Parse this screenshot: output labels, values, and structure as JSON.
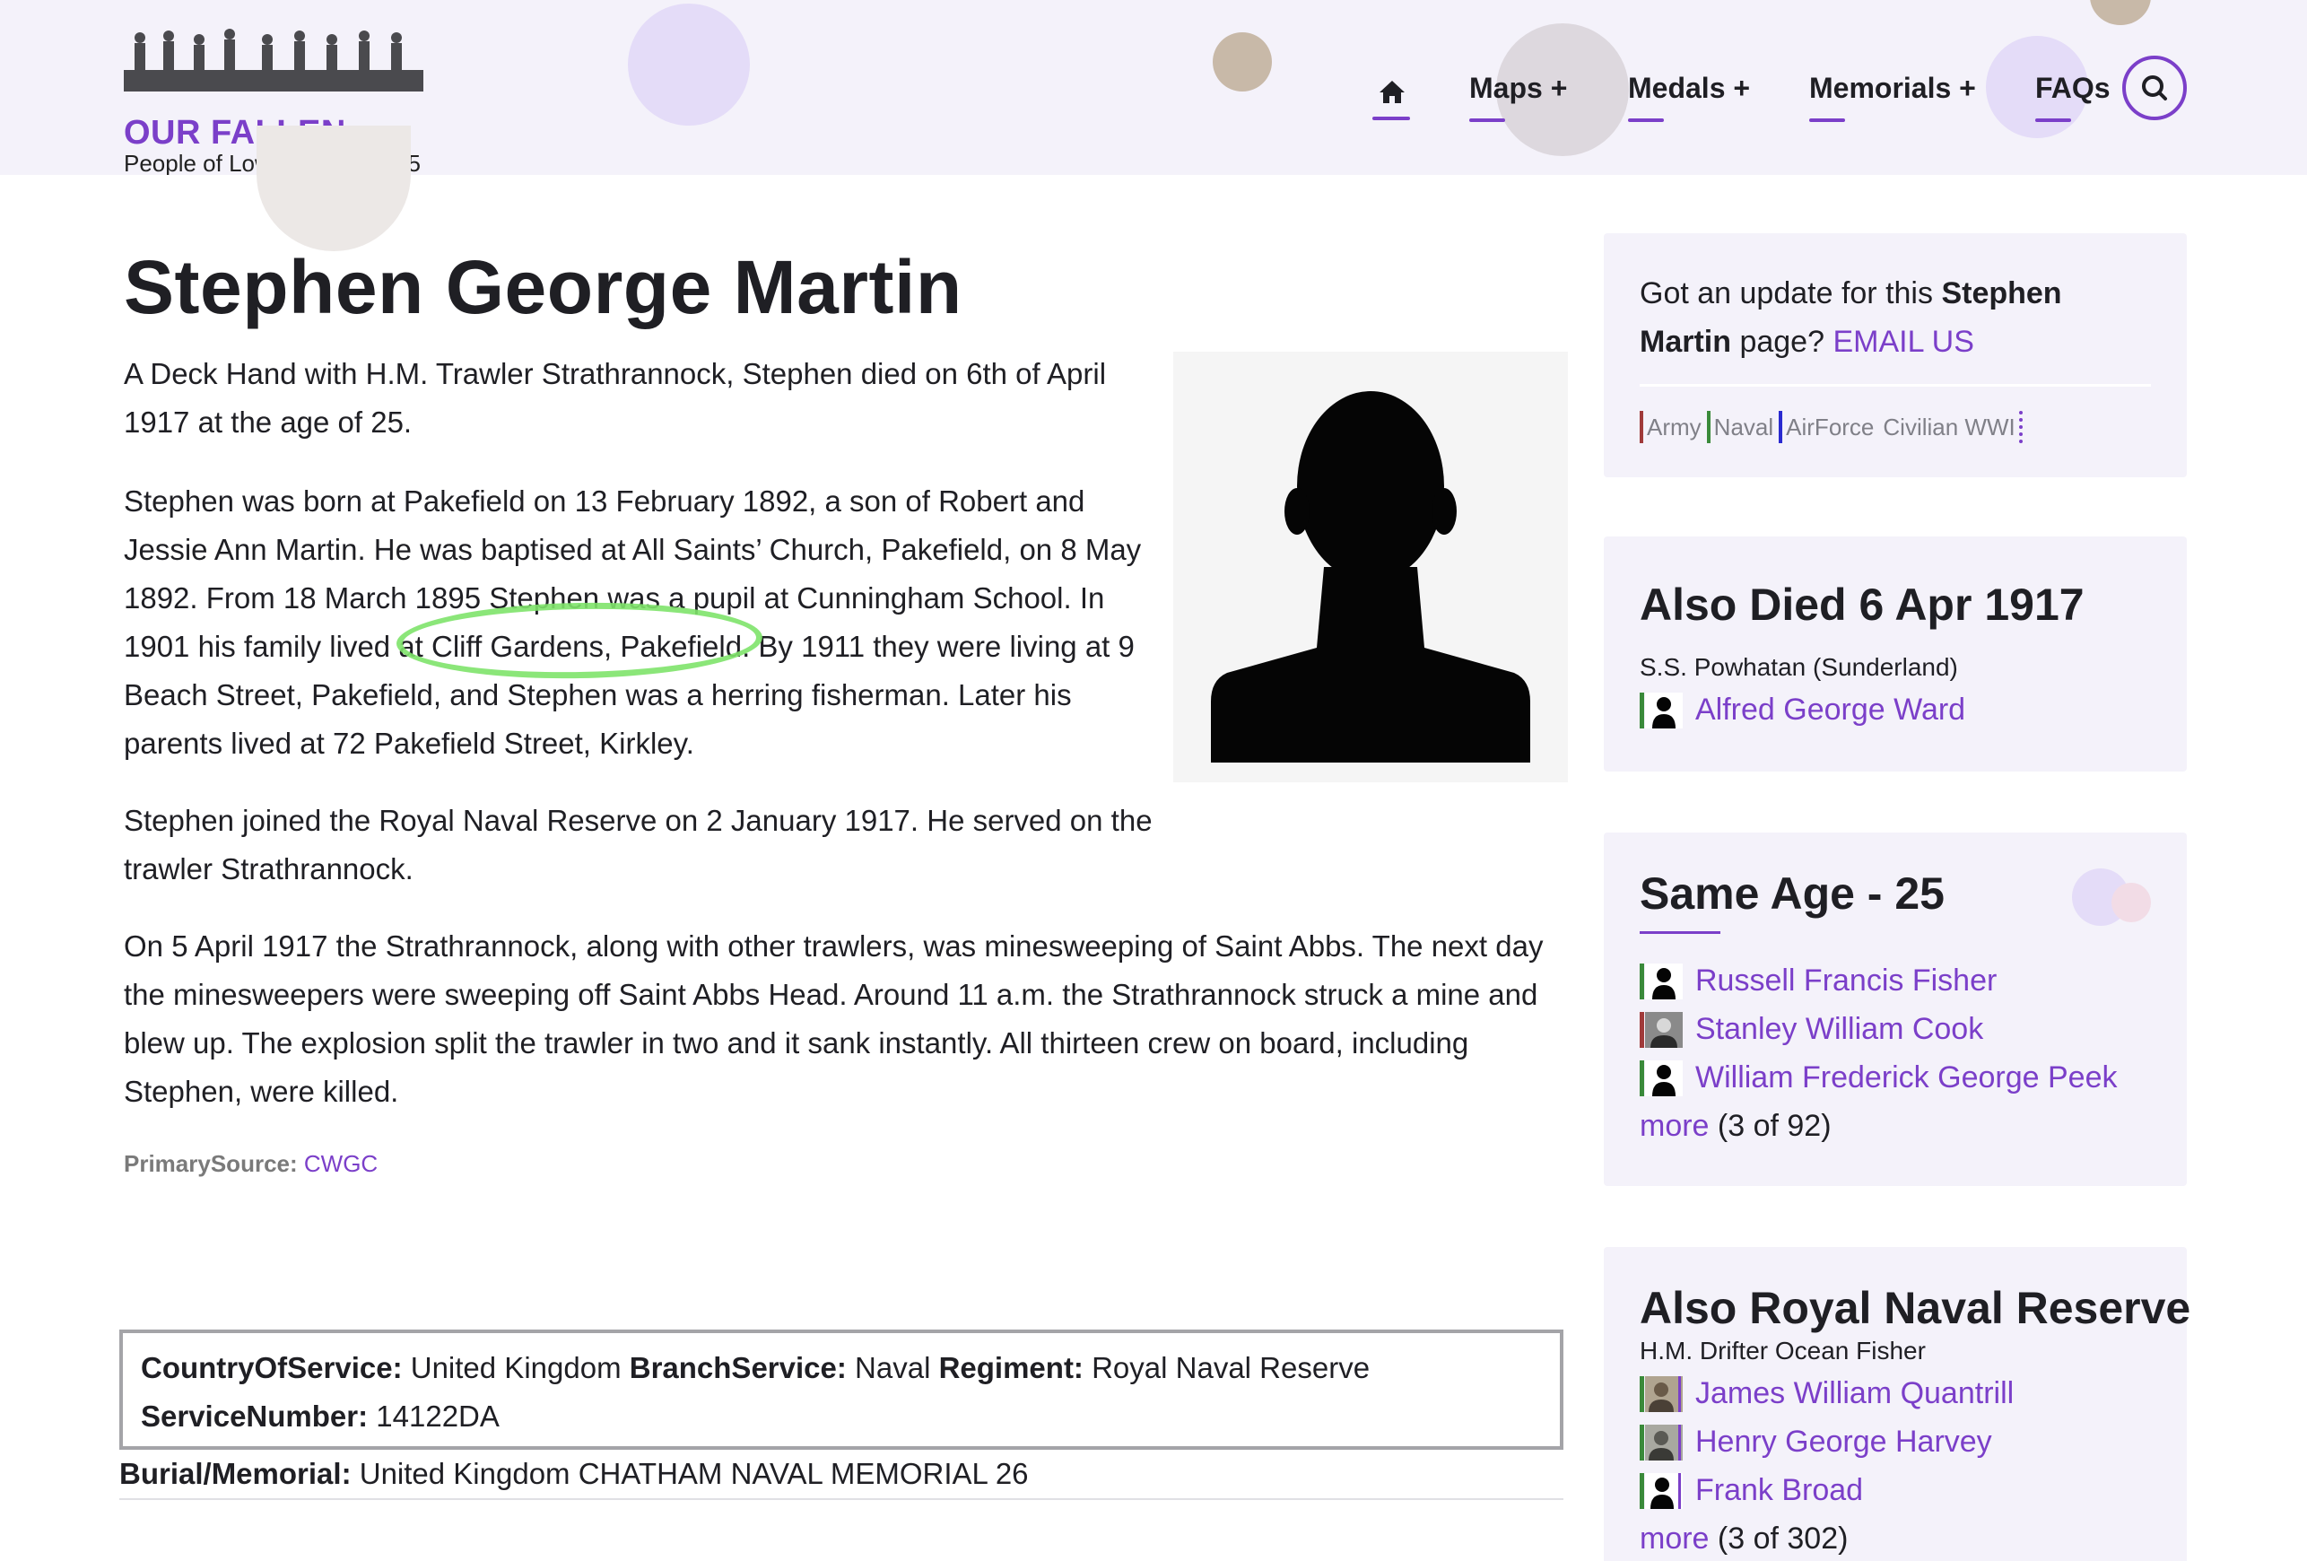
{
  "header": {
    "logo_title": "OUR FALLEN",
    "logo_subtitle": "People of Lowestoft 1914-45",
    "nav": [
      {
        "label": "Maps +"
      },
      {
        "label": "Medals +"
      },
      {
        "label": "Memorials +"
      },
      {
        "label": "FAQs"
      }
    ],
    "icons": {
      "home": "home-icon",
      "search": "search-icon"
    },
    "accent_color": "#7b3fc9"
  },
  "article": {
    "title": "Stephen George Martin",
    "paragraphs": [
      "A Deck Hand with H.M. Trawler Strathrannock, Stephen died on 6th of April 1917 at the age of 25.",
      "Stephen was born at Pakefield on 13 February 1892, a son of Robert and Jessie Ann Martin. He was baptised at All Saints’ Church, Pakefield, on 8 May 1892. From 18 March 1895 Stephen was a pupil at Cunningham School. In 1901 his family lived at Cliff Gardens, Pakefield. By 1911 they were living at 9 Beach Street, Pakefield, and Stephen was a herring fisherman. Later his parents lived at 72 Pakefield Street, Kirkley.",
      "Stephen joined the Royal Naval Reserve on 2 January 1917. He served on the trawler Strathrannock.",
      "On 5 April 1917 the Strathrannock, along with other trawlers, was minesweeping of Saint Abbs. The next day the minesweepers were sweeping off Saint Abbs Head. Around 11 a.m. the Strathrannock struck a mine and blew up. The explosion split the trawler in two and it sank instantly. All thirteen crew on board, including Stephen, were killed."
    ],
    "source_label": "PrimarySource:",
    "source_value": "CWGC"
  },
  "service": {
    "country_label": "CountryOfService:",
    "country_value": "United Kingdom",
    "branch_label": "BranchService:",
    "branch_value": "Naval",
    "regiment_label": "Regiment:",
    "regiment_value": "Royal Naval Reserve",
    "number_label": "ServiceNumber:",
    "number_value": "14122DA",
    "burial_label": "Burial/Memorial:",
    "burial_value": "United Kingdom CHATHAM NAVAL MEMORIAL 26"
  },
  "sidebar": {
    "update": {
      "text_pre": "Got an update for this ",
      "name": "Stephen Martin",
      "text_post": " page? ",
      "link": "EMAIL US",
      "branches": [
        "Army",
        "Naval",
        "AirForce",
        "Civilian WWI"
      ]
    },
    "also_died": {
      "title": "Also Died 6 Apr 1917",
      "subtitle": "S.S. Powhatan (Sunderland)",
      "people": [
        {
          "name": "Alfred George Ward",
          "thumb": "silhouette"
        }
      ]
    },
    "same_age": {
      "title": "Same Age - 25",
      "people": [
        {
          "name": "Russell Francis Fisher",
          "thumb": "silhouette"
        },
        {
          "name": "Stanley William Cook",
          "thumb": "photo"
        },
        {
          "name": "William Frederick George Peek",
          "thumb": "silhouette"
        }
      ],
      "more_link": "more",
      "more_count": "(3 of 92)"
    },
    "also_rnr": {
      "title": "Also Royal Naval Reserve",
      "subtitle": "H.M. Drifter Ocean Fisher",
      "people": [
        {
          "name": "James William Quantrill",
          "thumb": "photo"
        },
        {
          "name": "Henry George Harvey",
          "thumb": "photo"
        },
        {
          "name": "Frank Broad",
          "thumb": "silhouette"
        }
      ],
      "more_link": "more",
      "more_count": "(3 of 302)"
    }
  }
}
